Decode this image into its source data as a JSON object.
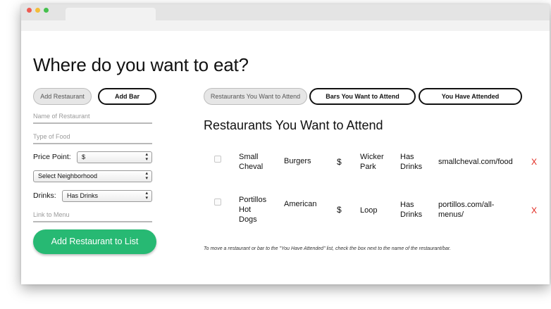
{
  "window": {
    "lights": [
      "#ee5b52",
      "#f3bd3a",
      "#45c04d"
    ]
  },
  "page": {
    "title": "Where do you want to eat?"
  },
  "form_toggle": {
    "add_restaurant": "Add Restaurant",
    "add_bar": "Add Bar"
  },
  "form": {
    "name_placeholder": "Name of Restaurant",
    "type_placeholder": "Type of Food",
    "price_label": "Price Point:",
    "price_value": "$",
    "neighborhood_value": "Select Neighborhood",
    "drinks_label": "Drinks:",
    "drinks_value": "Has Drinks",
    "menu_placeholder": "Link to Menu",
    "submit_label": "Add Restaurant to List"
  },
  "list_tabs": {
    "restaurants": "Restaurants You Want to Attend",
    "bars": "Bars You Want to Attend",
    "attended": "You Have Attended"
  },
  "list": {
    "heading": "Restaurants You Want to Attend",
    "rows": [
      {
        "name_lines": [
          "Small",
          "Cheval"
        ],
        "food": "Burgers",
        "price": "$",
        "hood_lines": [
          "Wicker",
          "Park"
        ],
        "drinks_lines": [
          "Has",
          "Drinks"
        ],
        "link_lines": [
          "smallcheval.com/food"
        ],
        "delete": "X"
      },
      {
        "name_lines": [
          "Portillos",
          "Hot",
          "Dogs"
        ],
        "food": "American",
        "price": "$",
        "hood_lines": [
          "Loop"
        ],
        "drinks_lines": [
          "Has",
          "Drinks"
        ],
        "link_lines": [
          "portillos.com/all-",
          "menus/"
        ],
        "delete": "X"
      }
    ],
    "note": "To move a restaurant or bar to the \"You Have Attended\" list, check the box next to the name of the restaurant/bar."
  }
}
